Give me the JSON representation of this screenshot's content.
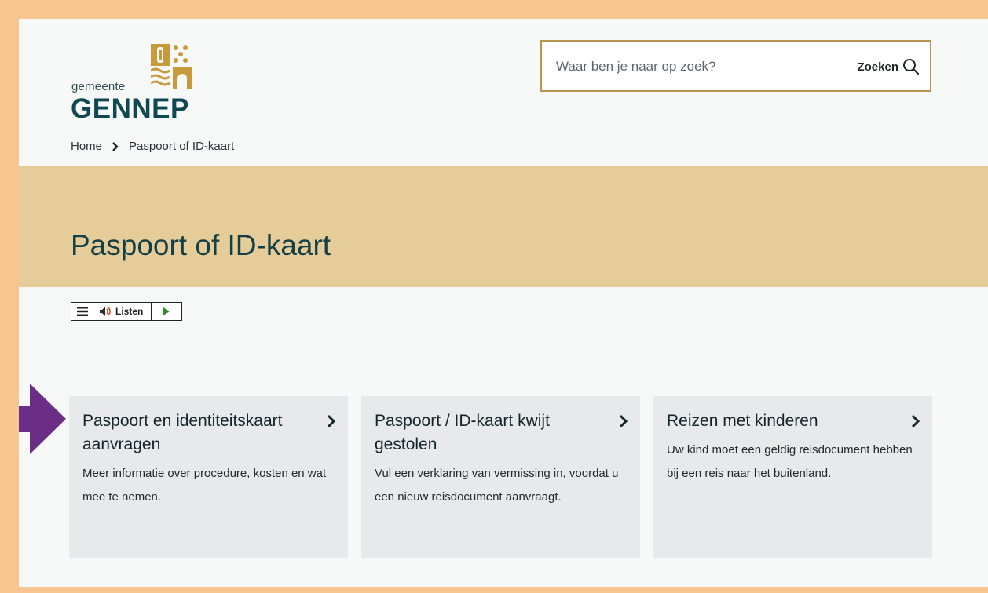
{
  "colors": {
    "outer_border": "#f7c58f",
    "hero_background": "#e6cc99",
    "card_background": "#e7e9ea",
    "brand_text": "#0f4853",
    "search_border": "#b9944c",
    "pointer_arrow": "#6b2d86"
  },
  "header": {
    "logo_small": "gemeente",
    "logo_big": "GENNEP",
    "logo_emblem_icon": "gennep-coat-of-arms-icon"
  },
  "search": {
    "placeholder": "Waar ben je naar op zoek?",
    "button_label": "Zoeken",
    "button_icon": "search-icon"
  },
  "breadcrumb": {
    "home": "Home",
    "separator_icon": "chevron-right-icon",
    "current": "Paspoort of ID-kaart"
  },
  "hero": {
    "title": "Paspoort of ID-kaart"
  },
  "listen_widget": {
    "menu_icon": "hamburger-menu-icon",
    "speaker_icon": "speaker-icon",
    "label": "Listen",
    "play_icon": "play-icon"
  },
  "pointer": {
    "icon": "arrow-right-icon"
  },
  "cards": [
    {
      "title": "Paspoort en identiteitskaart aanvragen",
      "description": "Meer informatie over procedure, kosten en wat mee te nemen."
    },
    {
      "title": "Paspoort / ID-kaart kwijt gestolen",
      "description": "Vul een verklaring van vermissing in, voordat u een nieuw reisdocument aanvraagt."
    },
    {
      "title": "Reizen met kinderen",
      "description": "Uw kind moet een geldig reisdocument hebben bij een reis naar het buitenland."
    }
  ]
}
